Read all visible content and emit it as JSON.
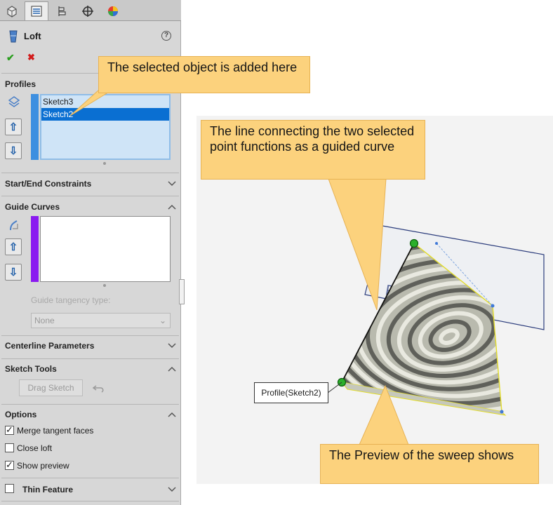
{
  "panel": {
    "tabs": [
      "feature-manager-tab",
      "property-manager-tab",
      "configuration-manager-tab",
      "dimxpert-tab",
      "display-manager-tab"
    ],
    "title": "Loft",
    "help_glyph": "?",
    "ok_glyph": "✔",
    "cancel_glyph": "✖",
    "profiles": {
      "heading": "Profiles",
      "items": [
        "Sketch3",
        "Sketch2"
      ],
      "selected_index": 1,
      "up_glyph": "⇧",
      "down_glyph": "⇩"
    },
    "start_end": {
      "heading": "Start/End Constraints"
    },
    "guide_curves": {
      "heading": "Guide Curves",
      "items": [],
      "tangency_label": "Guide tangency type:",
      "tangency_value": "None",
      "up_glyph": "⇧",
      "down_glyph": "⇩"
    },
    "centerline": {
      "heading": "Centerline Parameters"
    },
    "sketch_tools": {
      "heading": "Sketch Tools",
      "drag_sketch_label": "Drag Sketch"
    },
    "options": {
      "heading": "Options",
      "merge_tangent_label": "Merge tangent faces",
      "merge_tangent_checked": true,
      "close_loft_label": "Close loft",
      "close_loft_checked": false,
      "show_preview_label": "Show preview",
      "show_preview_checked": true
    },
    "thin_feature": {
      "label": "Thin Feature",
      "checked": false
    },
    "colors": {
      "profile_bar": "#3d8fe0",
      "guide_bar": "#8a1af0",
      "list_selection": "#0a6fd2"
    }
  },
  "viewport": {
    "plane_label": "Plane1",
    "profile_tag": "Profile(Sketch2)"
  },
  "callouts": {
    "selected_object": "The selected object is added here",
    "guide_line": "The line connecting the two selected point functions as a guided curve",
    "preview": "The Preview of the sweep shows"
  },
  "colors": {
    "callout_fill": "#fcd27d",
    "connector_point": "#2bb02b"
  }
}
